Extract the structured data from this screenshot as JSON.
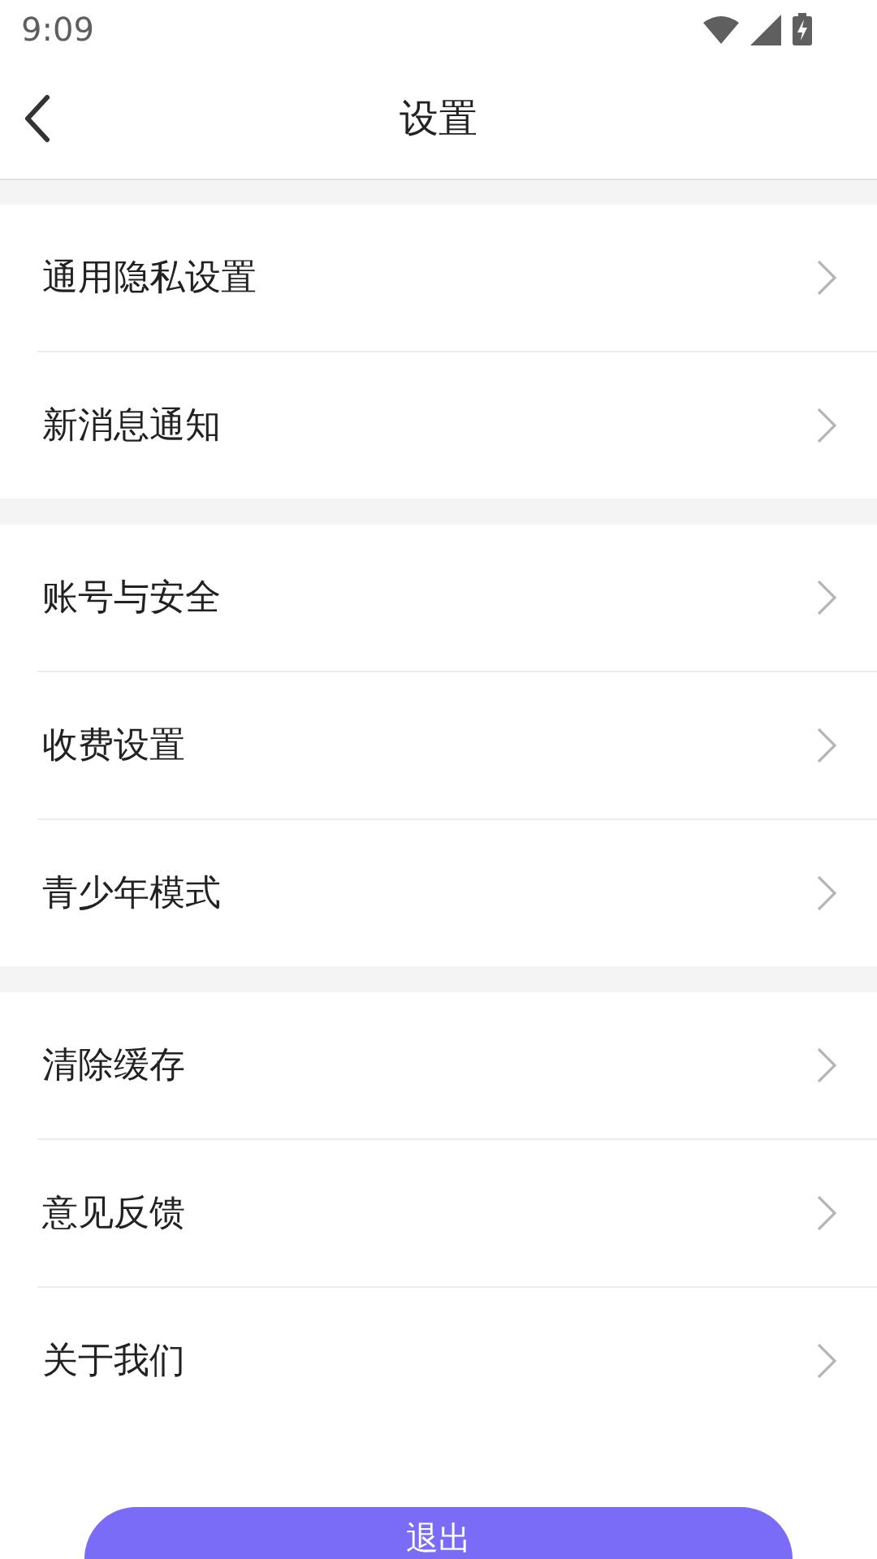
{
  "status_bar": {
    "time": "9:09"
  },
  "header": {
    "title": "设置"
  },
  "groups": [
    {
      "items": [
        {
          "label": "通用隐私设置"
        },
        {
          "label": "新消息通知"
        }
      ]
    },
    {
      "items": [
        {
          "label": "账号与安全"
        },
        {
          "label": "收费设置"
        },
        {
          "label": "青少年模式"
        }
      ]
    },
    {
      "items": [
        {
          "label": "清除缓存"
        },
        {
          "label": "意见反馈"
        },
        {
          "label": "关于我们"
        }
      ]
    }
  ],
  "logout_button": {
    "label": "退出"
  }
}
